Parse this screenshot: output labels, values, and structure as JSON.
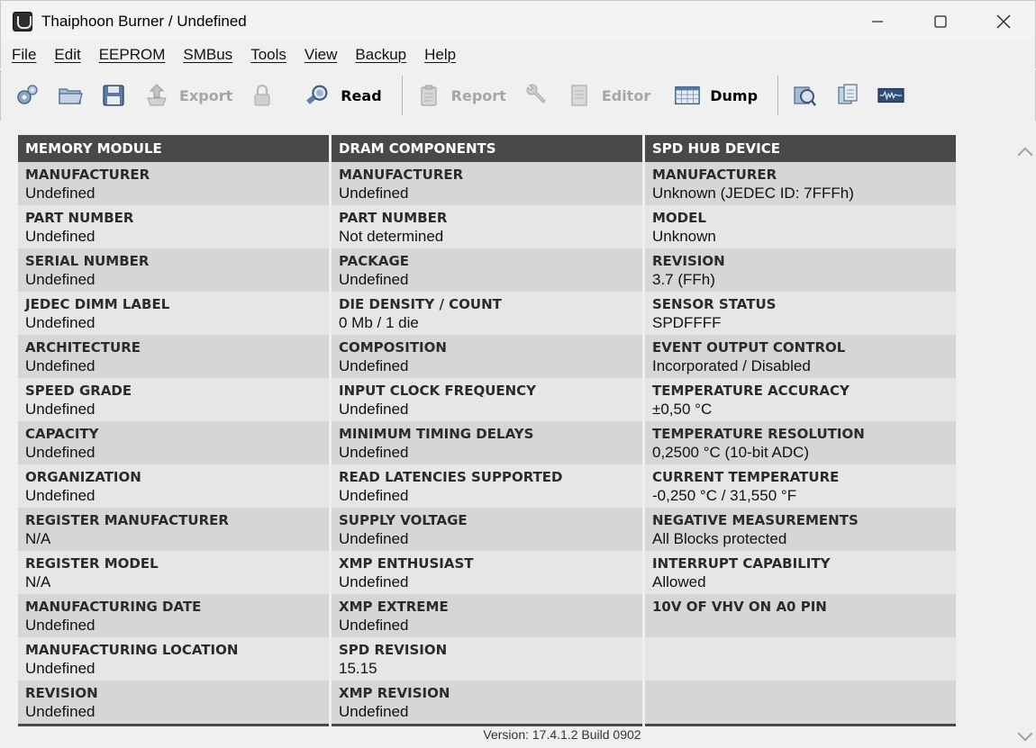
{
  "window": {
    "title": "Thaiphoon Burner / Undefined",
    "minimize": "—",
    "maximize": "☐",
    "close": "✕"
  },
  "menu": [
    "File",
    "Edit",
    "EEPROM",
    "SMBus",
    "Tools",
    "View",
    "Backup",
    "Help"
  ],
  "toolbar": {
    "export_label": "Export",
    "read_label": "Read",
    "report_label": "Report",
    "editor_label": "Editor",
    "dump_label": "Dump"
  },
  "table": {
    "columns": [
      {
        "header": "MEMORY MODULE",
        "rows": [
          {
            "label": "MANUFACTURER",
            "value": "Undefined"
          },
          {
            "label": "PART NUMBER",
            "value": "Undefined"
          },
          {
            "label": "SERIAL NUMBER",
            "value": "Undefined"
          },
          {
            "label": "JEDEC DIMM LABEL",
            "value": "Undefined"
          },
          {
            "label": "ARCHITECTURE",
            "value": "Undefined"
          },
          {
            "label": "SPEED GRADE",
            "value": "Undefined"
          },
          {
            "label": "CAPACITY",
            "value": "Undefined"
          },
          {
            "label": "ORGANIZATION",
            "value": "Undefined"
          },
          {
            "label": "REGISTER MANUFACTURER",
            "value": "N/A"
          },
          {
            "label": "REGISTER MODEL",
            "value": "N/A"
          },
          {
            "label": "MANUFACTURING DATE",
            "value": "Undefined"
          },
          {
            "label": "MANUFACTURING LOCATION",
            "value": "Undefined"
          },
          {
            "label": "REVISION",
            "value": "Undefined"
          }
        ]
      },
      {
        "header": "DRAM COMPONENTS",
        "rows": [
          {
            "label": "MANUFACTURER",
            "value": "Undefined"
          },
          {
            "label": "PART NUMBER",
            "value": "Not determined"
          },
          {
            "label": "PACKAGE",
            "value": "Undefined"
          },
          {
            "label": "DIE DENSITY / COUNT",
            "value": "0 Mb / 1 die"
          },
          {
            "label": "COMPOSITION",
            "value": "Undefined"
          },
          {
            "label": "INPUT CLOCK FREQUENCY",
            "value": "Undefined"
          },
          {
            "label": "MINIMUM TIMING DELAYS",
            "value": "Undefined"
          },
          {
            "label": "READ LATENCIES SUPPORTED",
            "value": "Undefined"
          },
          {
            "label": "SUPPLY VOLTAGE",
            "value": "Undefined"
          },
          {
            "label": "XMP ENTHUSIAST",
            "value": "Undefined"
          },
          {
            "label": "XMP EXTREME",
            "value": "Undefined"
          },
          {
            "label": "SPD REVISION",
            "value": "15.15"
          },
          {
            "label": "XMP REVISION",
            "value": "Undefined"
          }
        ]
      },
      {
        "header": "SPD HUB DEVICE",
        "rows": [
          {
            "label": "MANUFACTURER",
            "value": "Unknown (JEDEC ID: 7FFFh)"
          },
          {
            "label": "MODEL",
            "value": "Unknown"
          },
          {
            "label": "REVISION",
            "value": "3.7 (FFh)"
          },
          {
            "label": "SENSOR STATUS",
            "value": "SPDFFFF"
          },
          {
            "label": "EVENT OUTPUT CONTROL",
            "value": "Incorporated / Disabled"
          },
          {
            "label": "TEMPERATURE ACCURACY",
            "value": "±0,50 °C"
          },
          {
            "label": "TEMPERATURE RESOLUTION",
            "value": "0,2500 °C (10-bit ADC)"
          },
          {
            "label": "CURRENT TEMPERATURE",
            "value": "-0,250 °C / 31,550 °F"
          },
          {
            "label": "NEGATIVE MEASUREMENTS",
            "value": "All Blocks protected"
          },
          {
            "label": "INTERRUPT CAPABILITY",
            "value": "Allowed"
          },
          {
            "label": "10V OF VHV ON A0 PIN",
            "value": ""
          },
          {
            "label": "",
            "value": ""
          },
          {
            "label": "",
            "value": ""
          }
        ]
      }
    ]
  },
  "footer": {
    "version": "Version: 17.4.1.2 Build 0902"
  }
}
